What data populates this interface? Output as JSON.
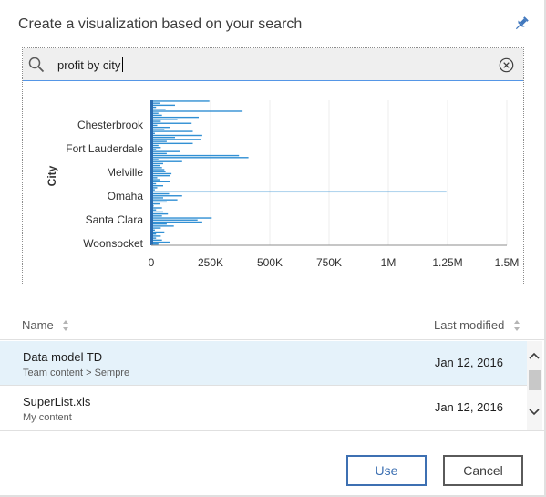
{
  "dialog": {
    "title": "Create a visualization based on your search",
    "pin_icon": "pin-icon"
  },
  "search": {
    "icon": "search-icon",
    "value": "profit by city",
    "clear_icon": "clear-circle-icon"
  },
  "chart_data": {
    "type": "bar",
    "orientation": "horizontal",
    "ylabel": "City",
    "xlabel": "",
    "xlim": [
      0,
      1500000
    ],
    "x_ticks": [
      "0",
      "250K",
      "500K",
      "750K",
      "1M",
      "1.25M",
      "1.5M"
    ],
    "visible_category_labels": [
      "Chesterbrook",
      "Fort Lauderdale",
      "Melville",
      "Omaha",
      "Santa Clara",
      "Woonsocket"
    ],
    "values": [
      245000,
      35000,
      100000,
      20000,
      60000,
      385000,
      30000,
      45000,
      200000,
      110000,
      40000,
      170000,
      25000,
      80000,
      55000,
      175000,
      15000,
      215000,
      100000,
      210000,
      65000,
      175000,
      30000,
      40000,
      20000,
      120000,
      65000,
      370000,
      410000,
      30000,
      130000,
      50000,
      35000,
      45000,
      55000,
      60000,
      85000,
      80000,
      25000,
      35000,
      80000,
      20000,
      50000,
      25000,
      15000,
      1245000,
      75000,
      130000,
      50000,
      110000,
      65000,
      35000,
      10000,
      45000,
      20000,
      50000,
      70000,
      45000,
      255000,
      195000,
      215000,
      65000,
      95000,
      40000,
      15000,
      55000,
      20000,
      40000,
      20000,
      45000,
      80000,
      30000
    ],
    "color": "#3290d4",
    "grid": true
  },
  "list": {
    "col_name": "Name",
    "col_modified": "Last modified",
    "sort_icon": "sort-arrows-icon",
    "rows": [
      {
        "name": "Data model TD",
        "location": "Team content > Sempre",
        "modified": "Jan 12, 2016",
        "selected": true
      },
      {
        "name": "SuperList.xls",
        "location": "My content",
        "modified": "Jan 12, 2016",
        "selected": false
      }
    ]
  },
  "scroll": {
    "up_icon": "chevron-up-icon",
    "down_icon": "chevron-down-icon"
  },
  "buttons": {
    "use": "Use",
    "cancel": "Cancel"
  },
  "colors": {
    "accent": "#3d70b2",
    "pin": "#4178be",
    "bar": "#3290d4",
    "selected_row": "#e5f2fa",
    "search_underline": "#5596e6"
  }
}
